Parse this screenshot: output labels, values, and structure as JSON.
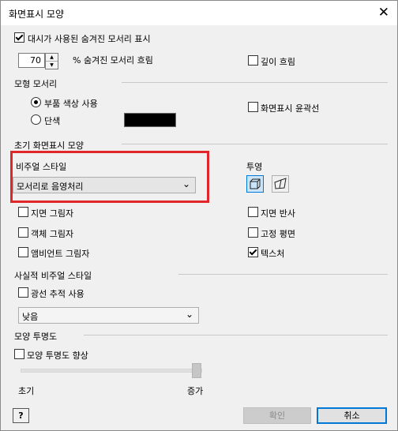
{
  "title": "화면표시 모양",
  "close_glyph": "✕",
  "silhouette": {
    "checkbox_label": "대시가 사용된 숨겨진 모서리 표시",
    "checked": true,
    "spinner_value": "70",
    "spinner_label": "% 숨겨진 모서리 흐림"
  },
  "depth_dim": {
    "label": "깊이 흐림",
    "checked": false
  },
  "model_edges": {
    "heading": "모형 모서리",
    "radio_part_color": "부품 색상 사용",
    "radio_single_color": "단색",
    "selected": "part_color",
    "swatch_color": "#000000",
    "silhouette_label": "화면표시 윤곽선",
    "silhouette_checked": false
  },
  "initial_display": {
    "heading": "초기 화면표시 모양",
    "visual_style_label": "비주얼 스타일",
    "visual_style_value": "모서리로 음영처리",
    "projection_label": "투영",
    "projection_selected": "orthographic"
  },
  "left_options": [
    {
      "label": "지면 그림자",
      "checked": false
    },
    {
      "label": "객체 그림자",
      "checked": false
    },
    {
      "label": "앰비언트 그림자",
      "checked": false
    }
  ],
  "right_options": [
    {
      "label": "지면 반사",
      "checked": false
    },
    {
      "label": "고정 평면",
      "checked": false
    },
    {
      "label": "텍스처",
      "checked": true
    }
  ],
  "realistic": {
    "heading": "사실적 비주얼 스타일",
    "raytrace_label": "광선 추적 사용",
    "raytrace_checked": false,
    "quality_value": "낮음"
  },
  "transparency": {
    "heading": "모양 투명도",
    "checkbox_label": "모양 투명도 향상",
    "checked": false,
    "slider_min_label": "초기",
    "slider_max_label": "증가",
    "slider_level": 1.0
  },
  "buttons": {
    "help": "?",
    "ok": "확인",
    "cancel": "취소"
  },
  "colors": {
    "highlight": "#e0262b",
    "focus": "#0078d7"
  }
}
